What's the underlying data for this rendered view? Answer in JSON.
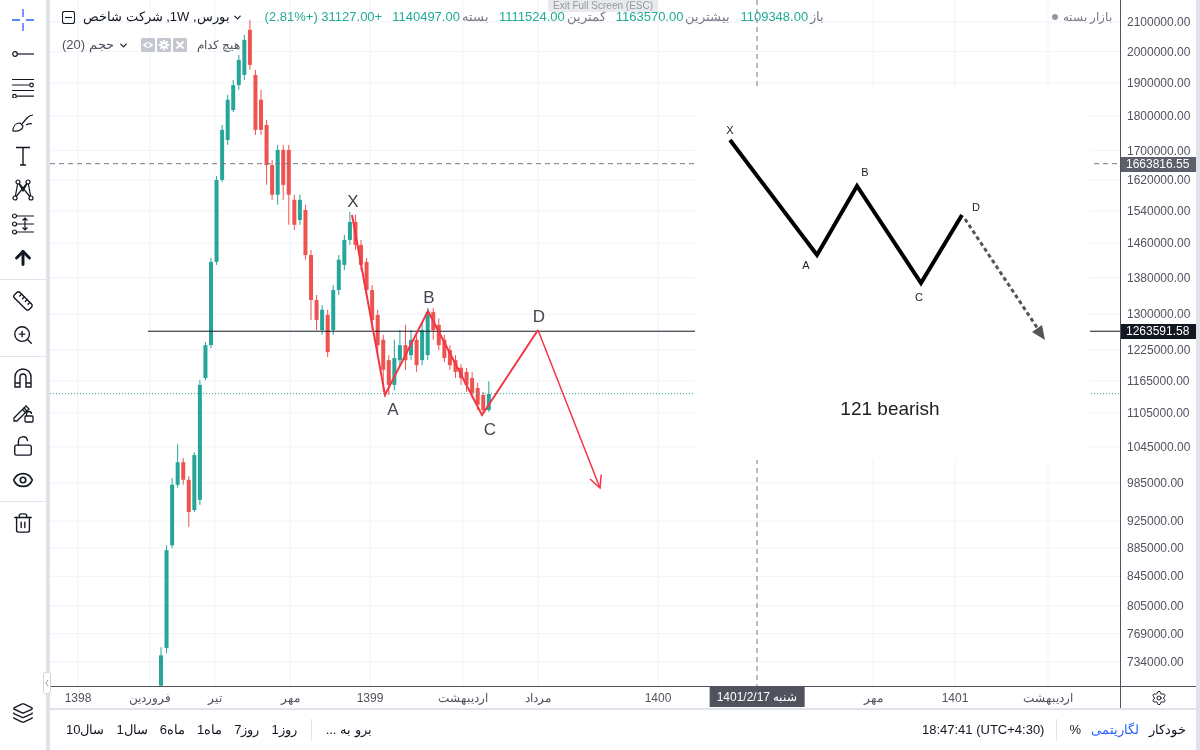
{
  "toolbar": {
    "groups": [
      {
        "tools": [
          {
            "kind": "crosshair",
            "selected": true
          },
          {
            "kind": "trend_line",
            "selected": false
          },
          {
            "kind": "fib_levels",
            "selected": false
          },
          {
            "kind": "brush",
            "selected": false
          },
          {
            "kind": "text",
            "selected": false
          },
          {
            "kind": "pattern",
            "selected": false
          },
          {
            "kind": "projection",
            "selected": false
          },
          {
            "kind": "arrow",
            "selected": false
          }
        ]
      },
      {
        "tools": [
          {
            "kind": "ruler",
            "selected": false
          },
          {
            "kind": "zoom",
            "selected": false
          }
        ]
      },
      {
        "tools": [
          {
            "kind": "magnet",
            "selected": false
          },
          {
            "kind": "lock_pencil",
            "selected": false
          },
          {
            "kind": "unlock",
            "selected": false
          },
          {
            "kind": "eye",
            "selected": false
          }
        ]
      },
      {
        "tools": [
          {
            "kind": "trash",
            "selected": false
          }
        ]
      }
    ]
  },
  "legend": {
    "symbol": "بورس, 1W, شرکت شاخص",
    "quote": [
      {
        "label": "باز",
        "value": "1109348.00"
      },
      {
        "label": "بیشترین",
        "value": "1163570.00"
      },
      {
        "label": "کمترین",
        "value": "1111524.00"
      },
      {
        "label": "بسته",
        "value": "1140497.00"
      }
    ],
    "change": "+31127.00 (+2.81%)",
    "indicator": {
      "title": "حجم (20)",
      "source": "هیچ کدام"
    }
  },
  "fullscreen_hint": "Exit Full Screen (ESC)",
  "market_status": "بازار بسته",
  "chart": {
    "price_axis": [
      "2100000.00",
      "2000000.00",
      "1900000.00",
      "1800000.00",
      "1700000.00",
      "1620000.00",
      "1540000.00",
      "1460000.00",
      "1380000.00",
      "1300000.00",
      "1225000.00",
      "1165000.00",
      "1105000.00",
      "1045000.00",
      "985000.00",
      "925000.00",
      "885000.00",
      "845000.00",
      "805000.00",
      "769000.00",
      "734000.00"
    ],
    "time_axis": [
      "اردیبهشت",
      "1401",
      "مهر",
      "1400",
      "مرداد",
      "اردیبهشت",
      "1399",
      "مهر",
      "تیر",
      "فروردین",
      "1398"
    ],
    "price_tags": [
      {
        "kind": "dashed",
        "text": "1663816.55"
      },
      {
        "kind": "solid",
        "text": "1263591.58"
      }
    ],
    "crosshair_date": "1401/2/17 شنبه",
    "pattern_labels": [
      "X",
      "A",
      "B",
      "C",
      "D"
    ]
  },
  "pattern_diagram": {
    "labels": [
      "X",
      "A",
      "B",
      "C",
      "D"
    ],
    "caption": "121 bearish"
  },
  "bottom_bar": {
    "ranges": [
      "1روز",
      "7روز",
      "1ماه",
      "6ماه",
      "1سال",
      "10سال"
    ],
    "goto": "برو به ...",
    "clock": "18:47:41 (UTC+4:30)",
    "scale_options": [
      {
        "label": "خودکار",
        "selected": false
      },
      {
        "label": "لگاریتمی",
        "selected": true
      },
      {
        "label": "%",
        "selected": false
      }
    ]
  }
}
